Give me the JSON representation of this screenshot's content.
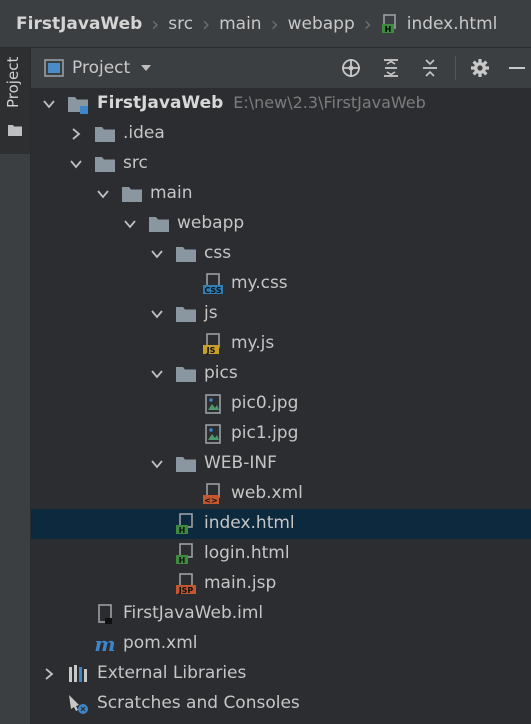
{
  "breadcrumb": {
    "root": "FirstJavaWeb",
    "items": [
      "src",
      "main",
      "webapp"
    ],
    "file": "index.html"
  },
  "side_tab": {
    "label": "Project"
  },
  "project_panel": {
    "title": "Project",
    "toolbar": [
      "locate-icon",
      "expand-all-icon",
      "collapse-all-icon",
      "settings-icon",
      "hide-icon"
    ]
  },
  "tree": {
    "root": {
      "label": "FirstJavaWeb",
      "path": "E:\\new\\2.3\\FirstJavaWeb"
    },
    "idea": "idea",
    "idea_label": ".idea",
    "src": "src",
    "main": "main",
    "webapp": "webapp",
    "css": "css",
    "my_css": "my.css",
    "js": "js",
    "my_js": "my.js",
    "pics": "pics",
    "pic0": "pic0.jpg",
    "pic1": "pic1.jpg",
    "webinf": "WEB-INF",
    "web_xml": "web.xml",
    "index_html": "index.html",
    "login_html": "login.html",
    "main_jsp": "main.jsp",
    "iml": "FirstJavaWeb.iml",
    "pom": "pom.xml",
    "ext_libs": "External Libraries",
    "scratches": "Scratches and Consoles"
  },
  "badges": {
    "css": "CSS",
    "js": "JS",
    "html": "H",
    "jsp": "JSP",
    "xml": "<>",
    "maven": "m"
  },
  "colors": {
    "accent_selection": "#0d293e",
    "folder": "#8a96a0",
    "html_badge": "#3e8a3e",
    "css_badge": "#2f7fb5",
    "js_badge": "#c9a027",
    "jsp_badge": "#c2562f",
    "xml_badge": "#c2562f",
    "maven": "#3f86c8"
  }
}
